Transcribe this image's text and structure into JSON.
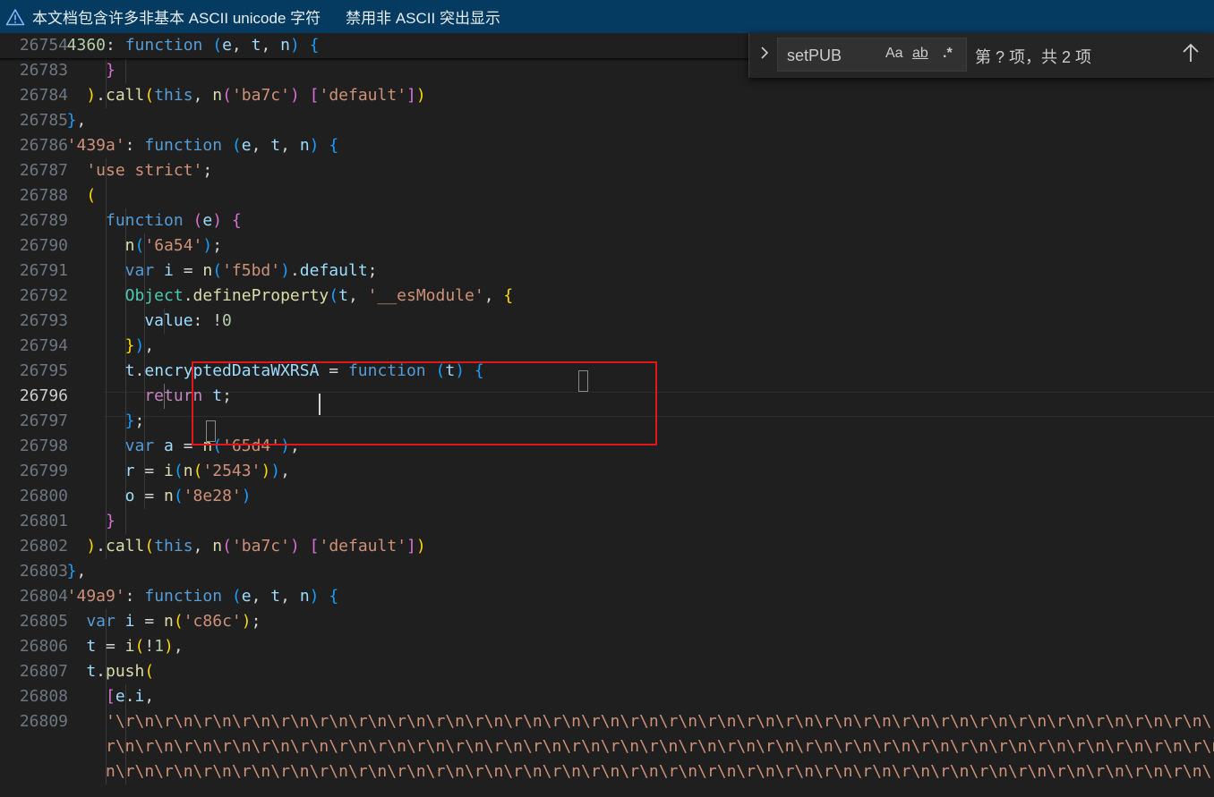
{
  "banner": {
    "message": "本文档包含许多非基本 ASCII unicode 字符",
    "action": "禁用非 ASCII 突出显示"
  },
  "find": {
    "query": "setPUB",
    "match_case_label": "Aa",
    "whole_word_label": "ab",
    "regex_label": ".*",
    "result_text": "第 ? 项，共 2 项"
  },
  "colors": {
    "banner_bg": "#063b61",
    "editor_bg": "#1f1f1f",
    "highlight_box": "#e5161a"
  },
  "editor": {
    "current_line": "26796",
    "lines": [
      {
        "num": "26754",
        "indent": 2,
        "tokens": [
          [
            "n",
            "4360"
          ],
          [
            "w",
            ": "
          ],
          [
            "k",
            "function"
          ],
          [
            "w",
            " "
          ],
          [
            "b3",
            "("
          ],
          [
            "v",
            "e"
          ],
          [
            "w",
            ", "
          ],
          [
            "v",
            "t"
          ],
          [
            "w",
            ", "
          ],
          [
            "v",
            "n"
          ],
          [
            "b3",
            ")"
          ],
          [
            "w",
            " "
          ],
          [
            "b3",
            "{"
          ]
        ]
      },
      {
        "num": "26783",
        "indent": 4,
        "tokens": [
          [
            "b2",
            "}"
          ]
        ]
      },
      {
        "num": "26784",
        "indent": 3,
        "tokens": [
          [
            "b1",
            ")"
          ],
          [
            "w",
            "."
          ],
          [
            "f",
            "call"
          ],
          [
            "b1",
            "("
          ],
          [
            "k",
            "this"
          ],
          [
            "w",
            ", "
          ],
          [
            "f",
            "n"
          ],
          [
            "b2",
            "("
          ],
          [
            "s",
            "'ba7c'"
          ],
          [
            "b2",
            ")"
          ],
          [
            "w",
            " "
          ],
          [
            "b2",
            "["
          ],
          [
            "s",
            "'default'"
          ],
          [
            "b2",
            "]"
          ],
          [
            "b1",
            ")"
          ]
        ]
      },
      {
        "num": "26785",
        "indent": 2,
        "tokens": [
          [
            "b3",
            "}"
          ],
          [
            "w",
            ","
          ]
        ]
      },
      {
        "num": "26786",
        "indent": 2,
        "tokens": [
          [
            "s",
            "'439a'"
          ],
          [
            "w",
            ": "
          ],
          [
            "k",
            "function"
          ],
          [
            "w",
            " "
          ],
          [
            "b3",
            "("
          ],
          [
            "v",
            "e"
          ],
          [
            "w",
            ", "
          ],
          [
            "v",
            "t"
          ],
          [
            "w",
            ", "
          ],
          [
            "v",
            "n"
          ],
          [
            "b3",
            ")"
          ],
          [
            "w",
            " "
          ],
          [
            "b3",
            "{"
          ]
        ]
      },
      {
        "num": "26787",
        "indent": 3,
        "tokens": [
          [
            "s",
            "'use strict'"
          ],
          [
            "w",
            ";"
          ]
        ]
      },
      {
        "num": "26788",
        "indent": 3,
        "tokens": [
          [
            "b1",
            "("
          ]
        ]
      },
      {
        "num": "26789",
        "indent": 4,
        "tokens": [
          [
            "k",
            "function"
          ],
          [
            "w",
            " "
          ],
          [
            "b2",
            "("
          ],
          [
            "v",
            "e"
          ],
          [
            "b2",
            ")"
          ],
          [
            "w",
            " "
          ],
          [
            "b2",
            "{"
          ]
        ]
      },
      {
        "num": "26790",
        "indent": 5,
        "tokens": [
          [
            "f",
            "n"
          ],
          [
            "b3",
            "("
          ],
          [
            "s",
            "'6a54'"
          ],
          [
            "b3",
            ")"
          ],
          [
            "w",
            ";"
          ]
        ]
      },
      {
        "num": "26791",
        "indent": 5,
        "tokens": [
          [
            "k",
            "var"
          ],
          [
            "w",
            " "
          ],
          [
            "v",
            "i"
          ],
          [
            "w",
            " = "
          ],
          [
            "f",
            "n"
          ],
          [
            "b3",
            "("
          ],
          [
            "s",
            "'f5bd'"
          ],
          [
            "b3",
            ")"
          ],
          [
            "w",
            "."
          ],
          [
            "v",
            "default"
          ],
          [
            "w",
            ";"
          ]
        ]
      },
      {
        "num": "26792",
        "indent": 5,
        "tokens": [
          [
            "t",
            "Object"
          ],
          [
            "w",
            "."
          ],
          [
            "f",
            "defineProperty"
          ],
          [
            "b3",
            "("
          ],
          [
            "v",
            "t"
          ],
          [
            "w",
            ", "
          ],
          [
            "s",
            "'__esModule'"
          ],
          [
            "w",
            ", "
          ],
          [
            "b1",
            "{"
          ]
        ]
      },
      {
        "num": "26793",
        "indent": 6,
        "tokens": [
          [
            "v",
            "value"
          ],
          [
            "w",
            ": !"
          ],
          [
            "n",
            "0"
          ]
        ]
      },
      {
        "num": "26794",
        "indent": 5,
        "tokens": [
          [
            "b1",
            "}"
          ],
          [
            "b3",
            ")"
          ],
          [
            "w",
            ","
          ]
        ]
      },
      {
        "num": "26795",
        "indent": 5,
        "tokens": [
          [
            "v",
            "t"
          ],
          [
            "w",
            "."
          ],
          [
            "v",
            "encryptedDataWXRSA"
          ],
          [
            "w",
            " = "
          ],
          [
            "k",
            "function"
          ],
          [
            "w",
            " "
          ],
          [
            "b3",
            "("
          ],
          [
            "v",
            "t"
          ],
          [
            "b3",
            ")"
          ],
          [
            "w",
            " "
          ],
          [
            "b3",
            "{"
          ]
        ]
      },
      {
        "num": "26796",
        "indent": 6,
        "tokens": [
          [
            "c",
            "return"
          ],
          [
            "w",
            " "
          ],
          [
            "v",
            "t"
          ],
          [
            "w",
            ";"
          ]
        ]
      },
      {
        "num": "26797",
        "indent": 5,
        "tokens": [
          [
            "b3",
            "}"
          ],
          [
            "w",
            ";"
          ]
        ]
      },
      {
        "num": "26798",
        "indent": 5,
        "tokens": [
          [
            "k",
            "var"
          ],
          [
            "w",
            " "
          ],
          [
            "v",
            "a"
          ],
          [
            "w",
            " = "
          ],
          [
            "f",
            "n"
          ],
          [
            "b3",
            "("
          ],
          [
            "s",
            "'65d4'"
          ],
          [
            "b3",
            ")"
          ],
          [
            "w",
            ","
          ]
        ]
      },
      {
        "num": "26799",
        "indent": 5,
        "tokens": [
          [
            "v",
            "r"
          ],
          [
            "w",
            " = "
          ],
          [
            "f",
            "i"
          ],
          [
            "b3",
            "("
          ],
          [
            "f",
            "n"
          ],
          [
            "b1",
            "("
          ],
          [
            "s",
            "'2543'"
          ],
          [
            "b1",
            ")"
          ],
          [
            "b3",
            ")"
          ],
          [
            "w",
            ","
          ]
        ]
      },
      {
        "num": "26800",
        "indent": 5,
        "tokens": [
          [
            "v",
            "o"
          ],
          [
            "w",
            " = "
          ],
          [
            "f",
            "n"
          ],
          [
            "b3",
            "("
          ],
          [
            "s",
            "'8e28'"
          ],
          [
            "b3",
            ")"
          ]
        ]
      },
      {
        "num": "26801",
        "indent": 4,
        "tokens": [
          [
            "b2",
            "}"
          ]
        ]
      },
      {
        "num": "26802",
        "indent": 3,
        "tokens": [
          [
            "b1",
            ")"
          ],
          [
            "w",
            "."
          ],
          [
            "f",
            "call"
          ],
          [
            "b1",
            "("
          ],
          [
            "k",
            "this"
          ],
          [
            "w",
            ", "
          ],
          [
            "f",
            "n"
          ],
          [
            "b2",
            "("
          ],
          [
            "s",
            "'ba7c'"
          ],
          [
            "b2",
            ")"
          ],
          [
            "w",
            " "
          ],
          [
            "b2",
            "["
          ],
          [
            "s",
            "'default'"
          ],
          [
            "b2",
            "]"
          ],
          [
            "b1",
            ")"
          ]
        ]
      },
      {
        "num": "26803",
        "indent": 2,
        "tokens": [
          [
            "b3",
            "}"
          ],
          [
            "w",
            ","
          ]
        ]
      },
      {
        "num": "26804",
        "indent": 2,
        "tokens": [
          [
            "s",
            "'49a9'"
          ],
          [
            "w",
            ": "
          ],
          [
            "k",
            "function"
          ],
          [
            "w",
            " "
          ],
          [
            "b3",
            "("
          ],
          [
            "v",
            "e"
          ],
          [
            "w",
            ", "
          ],
          [
            "v",
            "t"
          ],
          [
            "w",
            ", "
          ],
          [
            "v",
            "n"
          ],
          [
            "b3",
            ")"
          ],
          [
            "w",
            " "
          ],
          [
            "b3",
            "{"
          ]
        ]
      },
      {
        "num": "26805",
        "indent": 3,
        "tokens": [
          [
            "k",
            "var"
          ],
          [
            "w",
            " "
          ],
          [
            "v",
            "i"
          ],
          [
            "w",
            " = "
          ],
          [
            "f",
            "n"
          ],
          [
            "b1",
            "("
          ],
          [
            "s",
            "'c86c'"
          ],
          [
            "b1",
            ")"
          ],
          [
            "w",
            ";"
          ]
        ]
      },
      {
        "num": "26806",
        "indent": 3,
        "tokens": [
          [
            "v",
            "t"
          ],
          [
            "w",
            " = "
          ],
          [
            "f",
            "i"
          ],
          [
            "b1",
            "("
          ],
          [
            "w",
            "!"
          ],
          [
            "n",
            "1"
          ],
          [
            "b1",
            ")"
          ],
          [
            "w",
            ","
          ]
        ]
      },
      {
        "num": "26807",
        "indent": 3,
        "tokens": [
          [
            "v",
            "t"
          ],
          [
            "w",
            "."
          ],
          [
            "f",
            "push"
          ],
          [
            "b1",
            "("
          ]
        ]
      },
      {
        "num": "26808",
        "indent": 4,
        "tokens": [
          [
            "b2",
            "["
          ],
          [
            "v",
            "e"
          ],
          [
            "w",
            "."
          ],
          [
            "v",
            "i"
          ],
          [
            "w",
            ","
          ]
        ]
      },
      {
        "num": "26809",
        "indent": 4,
        "tokens": [
          [
            "s",
            "'\\r\\n\\r\\n\\r\\n\\r\\n\\r\\n\\r\\n\\r\\n\\r\\n\\r\\n\\r\\n\\r\\n\\r\\n\\r\\n\\r\\n\\r\\n\\r\\n\\r\\n\\r\\n\\r\\n\\r\\n\\r\\n\\r\\n\\r\\n\\r\\n\\r\\n\\r\\n\\r\\n\\r\\n\\r\\n\\r\\n\\r\\n\\r\\n\\r\\n\\r\\n\\r\\n\\r\\n\\r\\n\\r\\n\\r\\n\\r\\n\\r\\n\\r\\n\\r\\n\\r\\n\\r\\n\\r\\n\\r\\n\\r\\n\\r\\n\\r\\n\\r\\n\\r\\n\\r\\n"
          ]
        ]
      },
      {
        "num": "",
        "indent": 4,
        "tokens": [
          [
            "s",
            "r\\n\\r\\n\\r\\n\\r\\n\\r\\n\\r\\n\\r\\n\\r\\n\\r\\n\\r\\n\\r\\n\\r\\n\\r\\n\\r\\n\\r\\n\\r\\n\\r\\n\\r\\n\\r\\n\\r\\n\\r\\n\\r\\n\\r\\n\\r\\n\\r\\n\\r\\n\\r\\n\\r\\n\\r\\n\\r\\n\\r\\n\\r\\n\\r\\n\\r\\n\\r\\n\\r\\n\\r\\n\\r\\n\\r\\n\\r\\n\\r\\n\\r\\n\\r\\n\\r\\n\\r\\n\\r\\n\\r\\n\\r\\n\\r\\n\\r\\n\\r\\n\\r\\n\\r\\n\\r\\n"
          ]
        ]
      },
      {
        "num": "",
        "indent": 4,
        "tokens": [
          [
            "s",
            "n\\r\\n\\r\\n\\r\\n\\r\\n\\r\\n\\r\\n\\r\\n\\r\\n\\r\\n\\r\\n\\r\\n\\r\\n\\r\\n\\r\\n\\r\\n\\r\\n\\r\\n\\r\\n\\r\\n\\r\\n\\r\\n\\r\\n\\r\\n\\r\\n\\r\\n\\r\\n\\r\\n\\r\\n\\r\\n\\r\\n\\r\\n\\r\\n\\r\\n\\r\\n\\r\\n\\r\\n\\r\\n\\r\\n\\r\\n\\r\\n\\r\\n\\r\\n\\r\\n\\r\\n\\r\\n\\r\\n\\r\\n\\r\\n\\r\\n\\r\\n\\r\\n\\r\\n\\r\\n\\r\\n"
          ]
        ]
      }
    ]
  }
}
